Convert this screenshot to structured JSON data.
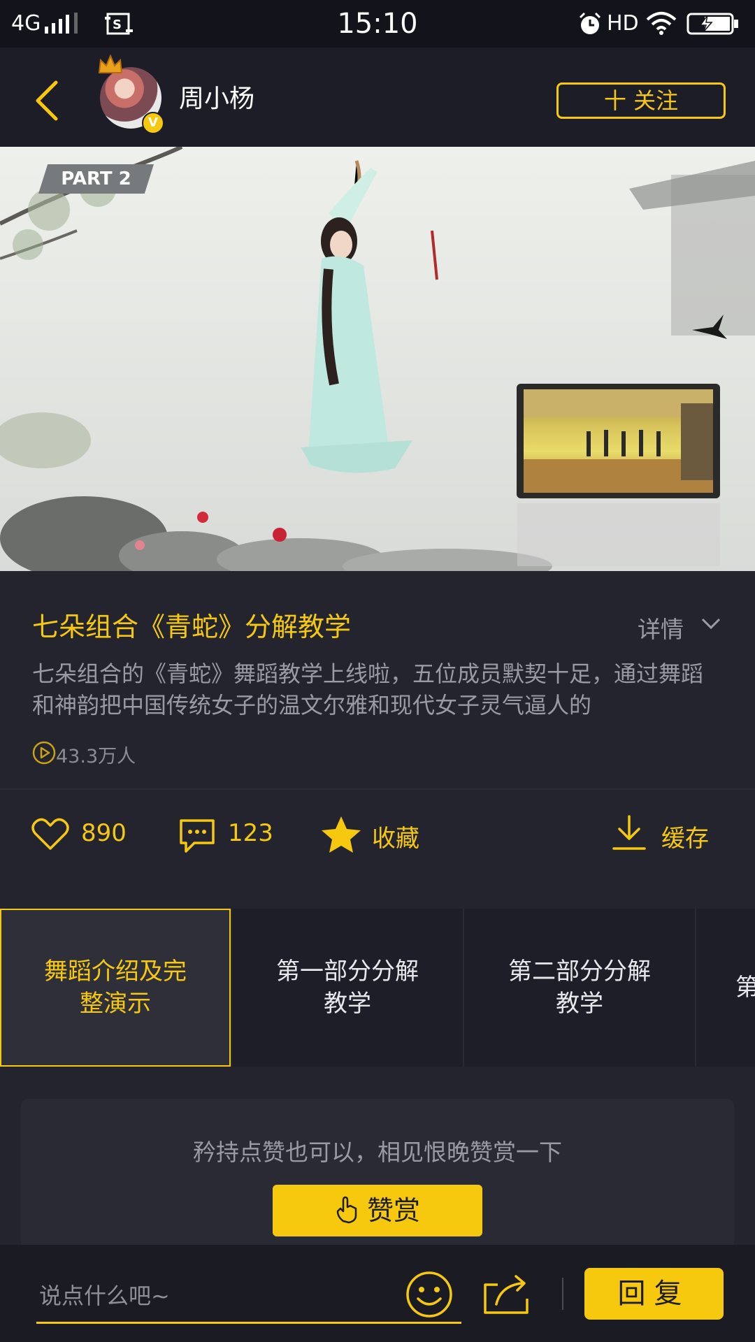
{
  "status_bar": {
    "network": "4G",
    "time": "15:10",
    "hd": "HD"
  },
  "header": {
    "username": "周小杨",
    "follow_label": "十 关注"
  },
  "video": {
    "part_label": "PART 2"
  },
  "info": {
    "title": "七朵组合《青蛇》分解教学",
    "detail_label": "详情",
    "description": "七朵组合的《青蛇》舞蹈教学上线啦，五位成员默契十足，通过舞蹈和神韵把中国传统女子的温文尔雅和现代女子灵气逼人的",
    "plays": "43.3万人"
  },
  "actions": {
    "likes": "890",
    "comments": "123",
    "favorite_label": "收藏",
    "download_label": "缓存"
  },
  "tabs": [
    {
      "label": "舞蹈介绍及完整演示",
      "active": true
    },
    {
      "label": "第一部分分解教学",
      "active": false
    },
    {
      "label": "第二部分分解教学",
      "active": false
    },
    {
      "label": "第",
      "active": false
    }
  ],
  "reward": {
    "prompt": "矜持点赞也可以，相见恨晚赞赏一下",
    "button_label": "赞赏"
  },
  "comment_bar": {
    "placeholder": "说点什么吧~",
    "reply_label": "回复"
  },
  "colors": {
    "accent": "#f6c90f",
    "background": "#24242e"
  }
}
